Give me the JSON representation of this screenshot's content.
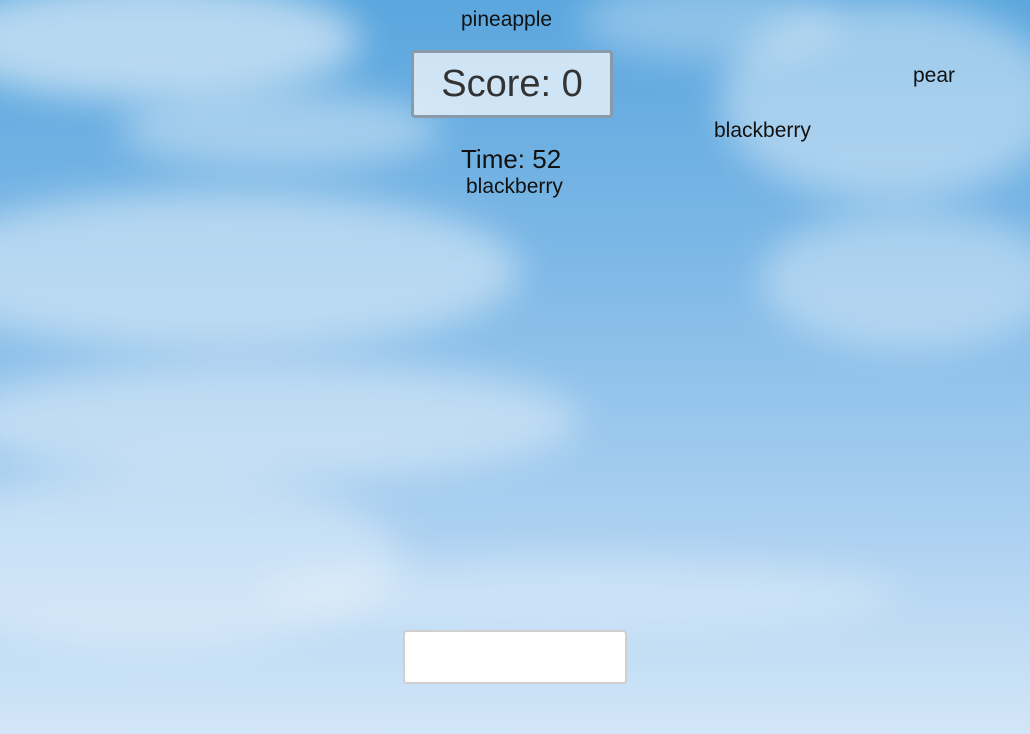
{
  "game": {
    "score_label": "Score: 0",
    "timer_label": "Time: 52",
    "input_value": "",
    "input_placeholder": ""
  },
  "falling_words": [
    "pineapple",
    "pear",
    "blackberry",
    "blackberry"
  ],
  "colors": {
    "sky_top": "#5aa6de",
    "sky_bottom": "#d2e6f7",
    "score_border": "#8a9aa8",
    "text": "#111111"
  }
}
